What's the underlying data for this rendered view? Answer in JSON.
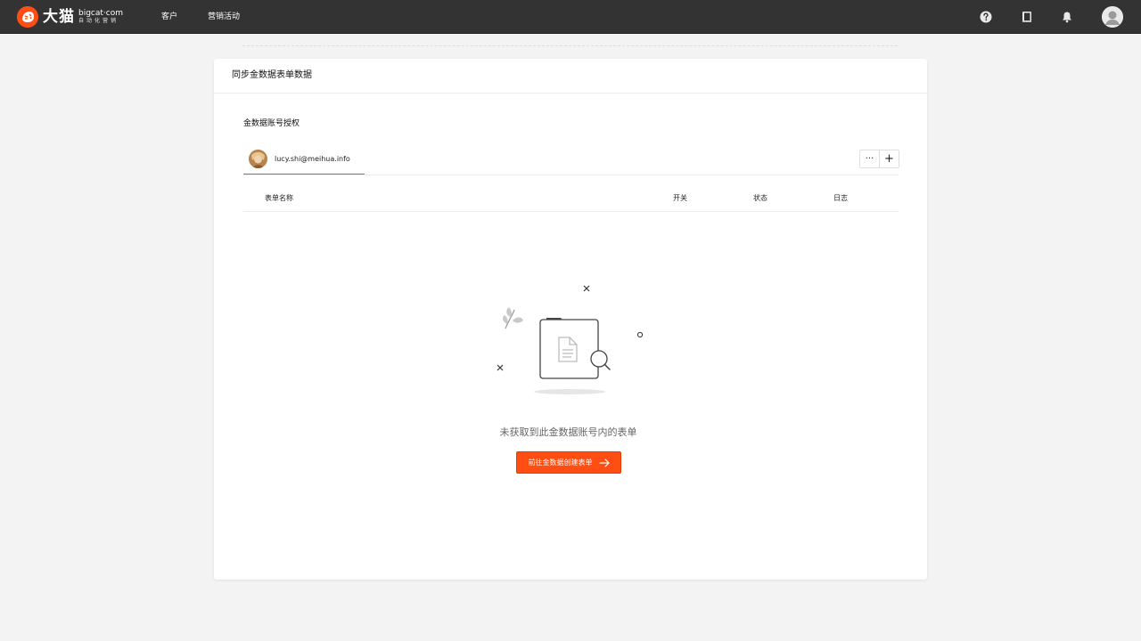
{
  "app": {
    "logo_cn": "大猫",
    "logo_domain": "bigcat·com",
    "logo_slogan": "自动化营销"
  },
  "nav": {
    "items": [
      {
        "label": "客户"
      },
      {
        "label": "营销活动"
      }
    ]
  },
  "header_icons": [
    "help-icon",
    "book-icon",
    "bell-icon",
    "user-avatar"
  ],
  "card": {
    "title": "同步金数据表单数据",
    "section_label": "金数据账号授权",
    "account_tab": {
      "email": "lucy.shi@meihua.info"
    },
    "actions": {
      "more": "···",
      "add": "+"
    },
    "table": {
      "columns": [
        "表单名称",
        "开关",
        "状态",
        "日志"
      ],
      "rows": []
    },
    "empty": {
      "message": "未获取到此金数据账号内的表单",
      "cta_label": "前往金数据创建表单"
    }
  },
  "colors": {
    "accent": "#ff4e14",
    "topbar": "#333333",
    "background": "#f3f3f3"
  }
}
